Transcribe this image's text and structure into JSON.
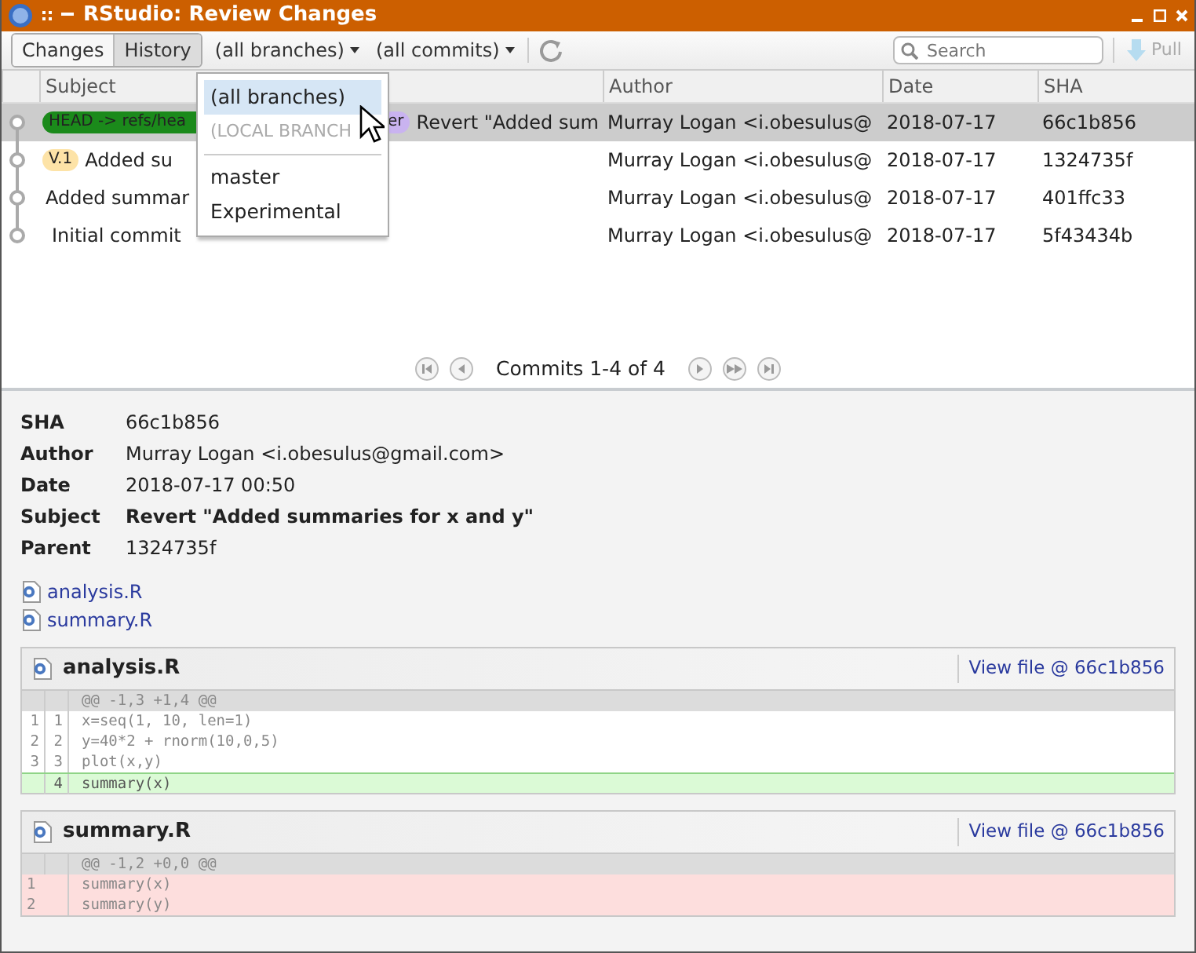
{
  "window": {
    "title": "RStudio: Review Changes"
  },
  "toolbar": {
    "tabs": [
      {
        "label": "Changes",
        "selected": false
      },
      {
        "label": "History",
        "selected": true
      }
    ],
    "branch_filter": "(all branches)",
    "commit_filter": "(all commits)",
    "search": {
      "placeholder": "Search"
    },
    "pull": {
      "label": "Pull",
      "disabled": true
    }
  },
  "table": {
    "columns": [
      "Subject",
      "Author",
      "Date",
      "SHA"
    ],
    "rows": [
      {
        "tags": [
          {
            "text": "HEAD -> refs/hea",
            "color": "#1b8a1b"
          },
          {
            "text": "er",
            "color": "#c9b3f0"
          }
        ],
        "subject": "Revert \"Added sum",
        "author": "Murray Logan <i.obesulus@",
        "date": "2018-07-17",
        "sha": "66c1b856",
        "selected": true
      },
      {
        "tags": [
          {
            "text": "V.1",
            "color": "#fde3a7"
          }
        ],
        "subject": "Added su",
        "author": "Murray Logan <i.obesulus@",
        "date": "2018-07-17",
        "sha": "1324735f",
        "selected": false
      },
      {
        "tags": [],
        "subject": "Added summar",
        "author": "Murray Logan <i.obesulus@",
        "date": "2018-07-17",
        "sha": "401ffc33",
        "selected": false
      },
      {
        "tags": [],
        "subject": "Initial commit",
        "author": "Murray Logan <i.obesulus@",
        "date": "2018-07-17",
        "sha": "5f43434b",
        "selected": false
      }
    ]
  },
  "branch_menu": [
    {
      "kind": "item",
      "label": "(all branches)",
      "selected": true
    },
    {
      "kind": "header",
      "label": "(LOCAL BRANCH"
    },
    {
      "kind": "divider"
    },
    {
      "kind": "item",
      "label": "master",
      "selected": false
    },
    {
      "kind": "item",
      "label": "Experimental",
      "selected": false
    }
  ],
  "pager": {
    "text": "Commits 1-4 of 4"
  },
  "details": [
    {
      "label": "SHA",
      "value": "66c1b856",
      "bold": false
    },
    {
      "label": "Author",
      "value": "Murray Logan <i.obesulus@gmail.com>",
      "bold": false
    },
    {
      "label": "Date",
      "value": "2018-07-17 00:50",
      "bold": false
    },
    {
      "label": "Subject",
      "value": "Revert \"Added summaries for x and y\"",
      "bold": true
    },
    {
      "label": "Parent",
      "value": "1324735f",
      "bold": false
    }
  ],
  "files": [
    "analysis.R",
    "summary.R"
  ],
  "diffs": [
    {
      "file": "analysis.R",
      "link": "View file @ 66c1b856",
      "hunk": "@@ -1,3 +1,4 @@",
      "lines": [
        {
          "kind": "context",
          "old": "1",
          "new": "1",
          "text": "x=seq(1, 10, len=1)"
        },
        {
          "kind": "context",
          "old": "2",
          "new": "2",
          "text": "y=40*2 + rnorm(10,0,5)"
        },
        {
          "kind": "context",
          "old": "3",
          "new": "3",
          "text": "plot(x,y)"
        },
        {
          "kind": "added",
          "new": "4",
          "text": "summary(x)"
        }
      ]
    },
    {
      "file": "summary.R",
      "link": "View file @ 66c1b856",
      "hunk": "@@ -1,2 +0,0 @@",
      "lines": [
        {
          "kind": "removed",
          "old": "1",
          "text": "summary(x)"
        },
        {
          "kind": "removed",
          "old": "2",
          "text": "summary(y)"
        }
      ]
    }
  ]
}
